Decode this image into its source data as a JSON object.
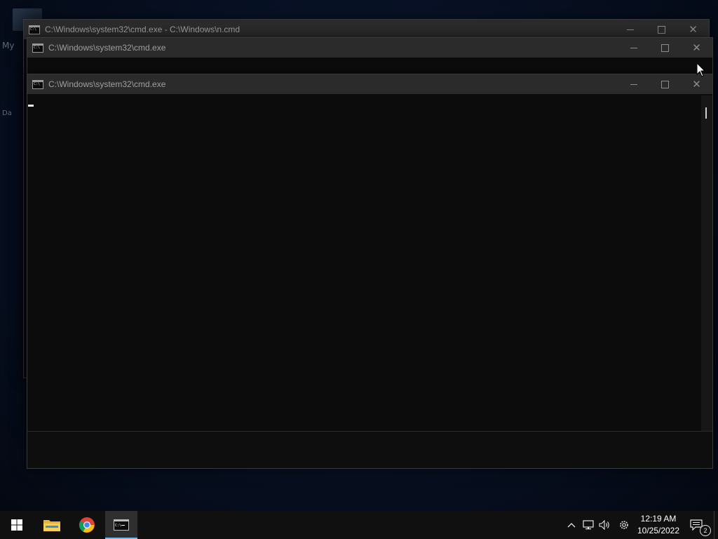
{
  "desktop": {
    "fragments": [
      "My",
      "Da"
    ]
  },
  "windows": {
    "back": {
      "title": "C:\\Windows\\system32\\cmd.exe - C:\\Windows\\n.cmd"
    },
    "middle": {
      "title": "C:\\Windows\\system32\\cmd.exe"
    },
    "front": {
      "title": "C:\\Windows\\system32\\cmd.exe"
    }
  },
  "taskbar": {
    "apps": [
      "start-menu",
      "file-explorer",
      "google-chrome",
      "command-prompt"
    ],
    "clock": {
      "time": "12:19 AM",
      "date": "10/25/2022"
    },
    "notifications_count": "2"
  },
  "colors": {
    "console_bg": "#0c0c0c",
    "titlebar_bg": "#2b2b2b",
    "taskbar_bg": "#101010",
    "active_task_indicator": "#76b9ed"
  }
}
